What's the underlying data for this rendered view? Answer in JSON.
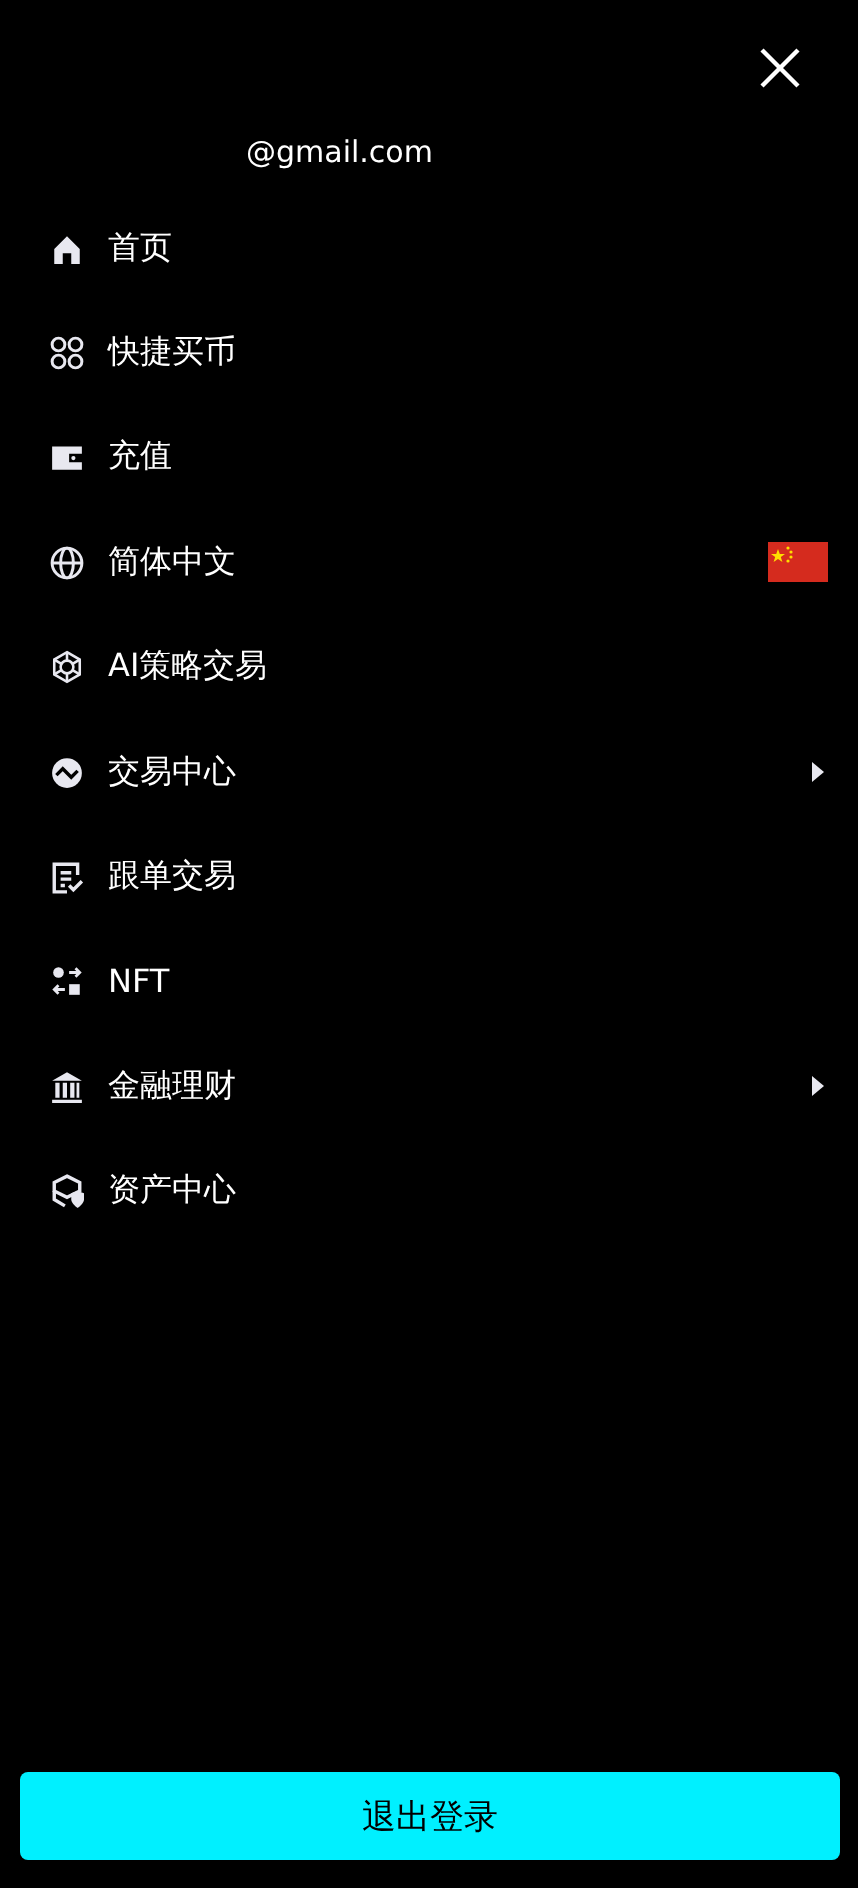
{
  "account": {
    "email": "@gmail.com"
  },
  "menu": [
    {
      "label": "首页",
      "kind": "link"
    },
    {
      "label": "快捷买币",
      "kind": "link"
    },
    {
      "label": "充值",
      "kind": "link"
    },
    {
      "label": "简体中文",
      "kind": "language"
    },
    {
      "label": "AI策略交易",
      "kind": "link"
    },
    {
      "label": "交易中心",
      "kind": "submenu"
    },
    {
      "label": "跟单交易",
      "kind": "link"
    },
    {
      "label": "NFT",
      "kind": "link"
    },
    {
      "label": "金融理财",
      "kind": "submenu"
    },
    {
      "label": "资产中心",
      "kind": "link"
    }
  ],
  "logout_button": {
    "label": "退出登录"
  }
}
